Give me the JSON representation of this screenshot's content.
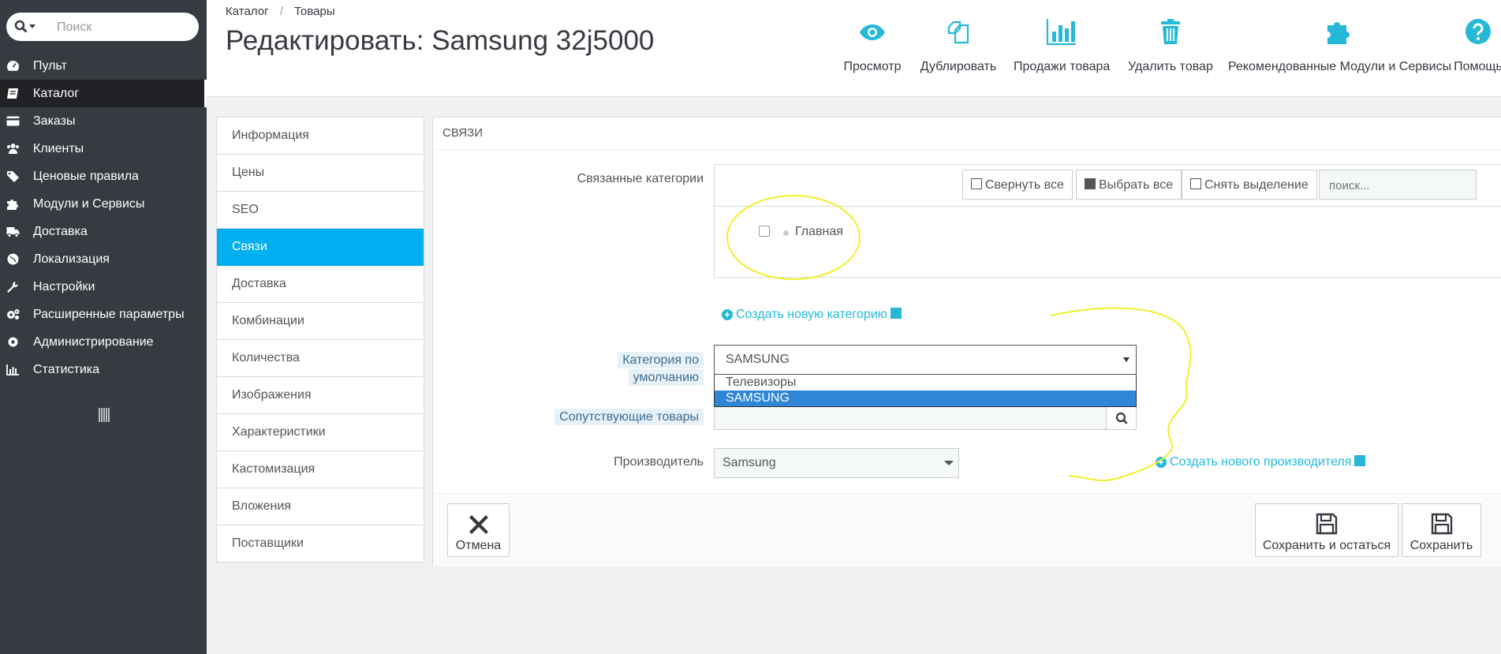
{
  "sidebar": {
    "search_placeholder": "Поиск",
    "items": [
      {
        "label": "Пульт",
        "icon": "dashboard-icon"
      },
      {
        "label": "Каталог",
        "icon": "book-icon",
        "active": true
      },
      {
        "label": "Заказы",
        "icon": "credit-card-icon"
      },
      {
        "label": "Клиенты",
        "icon": "users-icon"
      },
      {
        "label": "Ценовые правила",
        "icon": "tags-icon"
      },
      {
        "label": "Модули и Сервисы",
        "icon": "puzzle-icon"
      },
      {
        "label": "Доставка",
        "icon": "truck-icon"
      },
      {
        "label": "Локализация",
        "icon": "globe-icon"
      },
      {
        "label": "Настройки",
        "icon": "wrench-icon"
      },
      {
        "label": "Расширенные параметры",
        "icon": "cogs-icon"
      },
      {
        "label": "Администрирование",
        "icon": "gear-icon"
      },
      {
        "label": "Статистика",
        "icon": "bar-chart-icon"
      }
    ]
  },
  "header": {
    "breadcrumb": [
      "Каталог",
      "Товары"
    ],
    "breadcrumb_sep": "/",
    "title": "Редактировать: Samsung 32j5000",
    "toolbar": [
      {
        "label": "Просмотр",
        "icon": "eye-icon"
      },
      {
        "label": "Дублировать",
        "icon": "copy-icon"
      },
      {
        "label": "Продажи товара",
        "icon": "bar-chart-icon"
      },
      {
        "label": "Удалить товар",
        "icon": "trash-icon"
      },
      {
        "label": "Рекомендованные Модули и Сервисы",
        "icon": "puzzle-icon"
      },
      {
        "label": "Помощь",
        "icon": "help-icon"
      }
    ]
  },
  "tabs": [
    {
      "label": "Информация"
    },
    {
      "label": "Цены"
    },
    {
      "label": "SEO"
    },
    {
      "label": "Связи",
      "active": true
    },
    {
      "label": "Доставка"
    },
    {
      "label": "Комбинации"
    },
    {
      "label": "Количества"
    },
    {
      "label": "Изображения"
    },
    {
      "label": "Характеристики"
    },
    {
      "label": "Кастомизация"
    },
    {
      "label": "Вложения"
    },
    {
      "label": "Поставщики"
    }
  ],
  "panel": {
    "heading": "СВЯЗИ",
    "linked_categories_label": "Связанные категории",
    "collapse_all": "Свернуть все",
    "select_all": "Выбрать все",
    "deselect": "Снять выделение",
    "tree_search_placeholder": "поиск...",
    "tree_root": "Главная",
    "create_category": "Создать новую категорию",
    "default_category_label_1": "Категория по",
    "default_category_label_2": "умолчанию",
    "default_category_value": "SAMSUNG",
    "default_category_options": [
      "Телевизоры",
      "SAMSUNG"
    ],
    "accessories_label": "Сопутствующие товары",
    "manufacturer_label": "Производитель",
    "manufacturer_value": "Samsung",
    "create_manufacturer": "Создать нового производителя"
  },
  "footer": {
    "cancel": "Отмена",
    "save_and_stay": "Сохранить и остаться",
    "save": "Сохранить"
  },
  "colors": {
    "sidebar_bg": "#363a41",
    "accent": "#00aff0",
    "link": "#25b9d7",
    "annotation": "#f2ee2a"
  }
}
